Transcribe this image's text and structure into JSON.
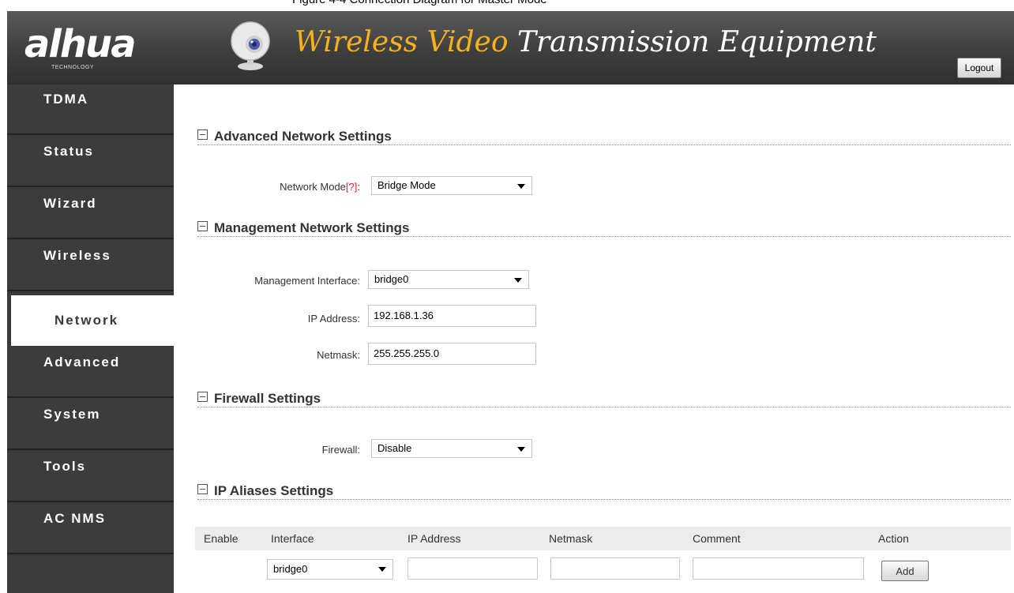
{
  "caption": "Figure 4-4 Connection Diagram for Master Mode",
  "header": {
    "logo_main": "alhua",
    "logo_sub": "TECHNOLOGY",
    "title_highlight": "Wireless Video",
    "title_rest": " Transmission Equipment",
    "logout_label": "Logout"
  },
  "sidebar": {
    "items": [
      {
        "label": "TDMA"
      },
      {
        "label": "Status"
      },
      {
        "label": "Wizard"
      },
      {
        "label": "Wireless"
      },
      {
        "label": "Network",
        "active": true
      },
      {
        "label": "Advanced"
      },
      {
        "label": "System"
      },
      {
        "label": "Tools"
      },
      {
        "label": "AC NMS"
      }
    ]
  },
  "sections": {
    "advanced": {
      "title": "Advanced Network Settings",
      "network_mode_label": "Network Mode",
      "help_marker": "[?]",
      "colon": ":",
      "network_mode_value": "Bridge Mode"
    },
    "management": {
      "title": "Management Network Settings",
      "interface_label": "Management Interface:",
      "interface_value": "bridge0",
      "ip_label": "IP Address:",
      "ip_value": "192.168.1.36",
      "netmask_label": "Netmask:",
      "netmask_value": "255.255.255.0"
    },
    "firewall": {
      "title": "Firewall Settings",
      "firewall_label": "Firewall:",
      "firewall_value": "Disable"
    },
    "ip_aliases": {
      "title": "IP Aliases Settings",
      "columns": [
        "Enable",
        "Interface",
        "IP Address",
        "Netmask",
        "Comment",
        "Action"
      ],
      "row": {
        "interface_value": "bridge0",
        "ip_value": "",
        "netmask_value": "",
        "comment_value": "",
        "action_label": "Add"
      }
    }
  },
  "colors": {
    "accent": "#f6b21b",
    "sidebar_bg": "#3c3c3c",
    "header_bg": "#3e3e3e"
  }
}
